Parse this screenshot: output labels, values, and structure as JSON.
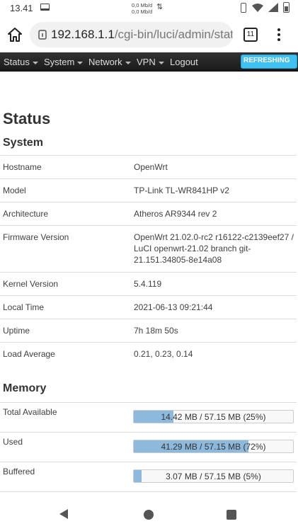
{
  "statusbar": {
    "time": "13.41",
    "net_up": "0,0 Mb/d",
    "net_down": "0,0 Mb/d",
    "net_arrows": "⇅"
  },
  "browser": {
    "url_host": "192.168.1.1",
    "url_path": "/cgi-bin/luci/admin/status",
    "tab_count": "11"
  },
  "menubar": {
    "items": [
      {
        "label": "Status",
        "dropdown": true
      },
      {
        "label": "System",
        "dropdown": true
      },
      {
        "label": "Network",
        "dropdown": true
      },
      {
        "label": "VPN",
        "dropdown": true
      },
      {
        "label": "Logout",
        "dropdown": false
      }
    ],
    "refresh_label": "REFRESHING"
  },
  "page": {
    "title": "Status"
  },
  "system": {
    "heading": "System",
    "rows": [
      {
        "key": "Hostname",
        "value": "OpenWrt"
      },
      {
        "key": "Model",
        "value": "TP-Link TL-WR841HP v2"
      },
      {
        "key": "Architecture",
        "value": "Atheros AR9344 rev 2"
      },
      {
        "key": "Firmware Version",
        "value": "OpenWrt 21.02.0-rc2 r16122-c2139eef27 / LuCI openwrt-21.02 branch git-21.151.34805-8e14a08"
      },
      {
        "key": "Kernel Version",
        "value": "5.4.119"
      },
      {
        "key": "Local Time",
        "value": "2021-06-13 09:21:44"
      },
      {
        "key": "Uptime",
        "value": "7h 18m 50s"
      },
      {
        "key": "Load Average",
        "value": "0.21, 0.23, 0.14"
      }
    ]
  },
  "memory": {
    "heading": "Memory",
    "rows": [
      {
        "key": "Total Available",
        "value": "14.42 MB / 57.15 MB (25%)",
        "percent": 25
      },
      {
        "key": "Used",
        "value": "41.29 MB / 57.15 MB (72%)",
        "percent": 72
      },
      {
        "key": "Buffered",
        "value": "3.07 MB / 57.15 MB (5%)",
        "percent": 5
      }
    ]
  },
  "icons": {
    "home": "home-icon",
    "lock": "lock-icon",
    "menu": "more-vert-icon"
  },
  "colors": {
    "menubar_bg": "#222222",
    "refresh_badge": "#3ec0f0",
    "progress_fill": "#8cb9dc"
  }
}
